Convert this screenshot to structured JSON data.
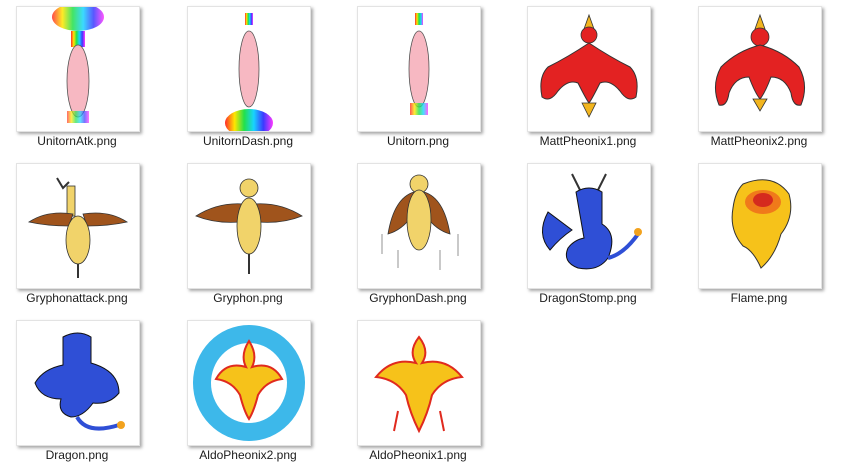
{
  "files": [
    {
      "name": "UnitornAtk.png",
      "icon": "unicorn-attack-thumbnail"
    },
    {
      "name": "UnitornDash.png",
      "icon": "unicorn-dash-thumbnail"
    },
    {
      "name": "Unitorn.png",
      "icon": "unicorn-thumbnail"
    },
    {
      "name": "MattPheonix1.png",
      "icon": "red-phoenix-thumbnail"
    },
    {
      "name": "MattPheonix2.png",
      "icon": "red-phoenix-thumbnail"
    },
    {
      "name": "Gryphonattack.png",
      "icon": "gryphon-attack-thumbnail"
    },
    {
      "name": "Gryphon.png",
      "icon": "gryphon-thumbnail"
    },
    {
      "name": "GryphonDash.png",
      "icon": "gryphon-dash-thumbnail"
    },
    {
      "name": "DragonStomp.png",
      "icon": "blue-dragon-stomp-thumbnail"
    },
    {
      "name": "Flame.png",
      "icon": "flame-thumbnail"
    },
    {
      "name": "Dragon.png",
      "icon": "blue-dragon-thumbnail"
    },
    {
      "name": "AldoPheonix2.png",
      "icon": "fire-ice-phoenix-thumbnail"
    },
    {
      "name": "AldoPheonix1.png",
      "icon": "fire-phoenix-thumbnail"
    }
  ],
  "colors": {
    "background": "#ffffff",
    "label_text": "#1b1b1b",
    "phoenix_red": "#e32222",
    "gryphon_brown": "#a0541c",
    "dragon_blue": "#2f4fd6",
    "flame_yellow": "#f6c21a"
  }
}
